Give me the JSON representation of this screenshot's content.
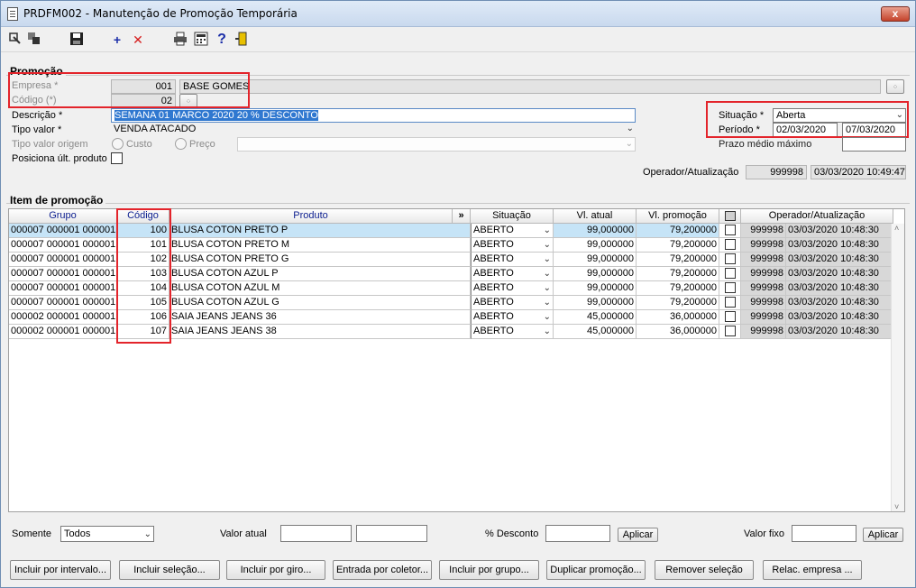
{
  "window": {
    "title": "PRDFM002 - Manutenção de Promoção Temporária",
    "close_symbol": "x"
  },
  "toolbar": {
    "icons": [
      "exit-icon",
      "copy-icon",
      "save-icon",
      "add-icon",
      "delete-icon",
      "print-icon",
      "calculator-icon",
      "help-icon",
      "door-icon"
    ],
    "add_glyph": "+",
    "delete_glyph": "✕",
    "help_glyph": "?"
  },
  "promocao": {
    "group_title": "Promoção",
    "empresa_label": "Empresa *",
    "empresa_code": "001",
    "empresa_name": "BASE GOMES",
    "codigo_label": "Código (*)",
    "codigo_value": "02",
    "descricao_label": "Descrição *",
    "descricao_value": "SEMANA 01 MARCO 2020 20 % DESCONTO",
    "tipo_valor_label": "Tipo valor *",
    "tipo_valor_value": "VENDA ATACADO",
    "tipo_valor_origem_label": "Tipo valor origem",
    "radio_custo": "Custo",
    "radio_preco": "Preço",
    "posiciona_label": "Posiciona últ. produto",
    "situacao_label": "Situação *",
    "situacao_value": "Aberta",
    "periodo_label": "Período *",
    "periodo_inicio": "02/03/2020",
    "periodo_fim": "07/03/2020",
    "prazo_label": "Prazo médio máximo",
    "prazo_value": "",
    "operador_label": "Operador/Atualização",
    "operador_value": "999998",
    "atualizacao_value": "03/03/2020 10:49:47"
  },
  "itens": {
    "group_title": "Item de promoção",
    "columns": {
      "grupo": "Grupo",
      "codigo": "Código",
      "produto": "Produto",
      "expand": "»",
      "situacao": "Situação",
      "vl_atual": "Vl. atual",
      "vl_promocao": "Vl. promoção",
      "operador": "Operador/Atualização"
    },
    "rows": [
      {
        "grupo": "000007 000001 000001",
        "codigo": "100",
        "produto": "BLUSA COTON PRETO P",
        "situacao": "ABERTO",
        "vl_atual": "99,000000",
        "vl_promocao": "79,200000",
        "operador": "999998",
        "atualizacao": "03/03/2020 10:48:30"
      },
      {
        "grupo": "000007 000001 000001",
        "codigo": "101",
        "produto": "BLUSA COTON PRETO M",
        "situacao": "ABERTO",
        "vl_atual": "99,000000",
        "vl_promocao": "79,200000",
        "operador": "999998",
        "atualizacao": "03/03/2020 10:48:30"
      },
      {
        "grupo": "000007 000001 000001",
        "codigo": "102",
        "produto": "BLUSA COTON PRETO G",
        "situacao": "ABERTO",
        "vl_atual": "99,000000",
        "vl_promocao": "79,200000",
        "operador": "999998",
        "atualizacao": "03/03/2020 10:48:30"
      },
      {
        "grupo": "000007 000001 000001",
        "codigo": "103",
        "produto": "BLUSA COTON AZUL P",
        "situacao": "ABERTO",
        "vl_atual": "99,000000",
        "vl_promocao": "79,200000",
        "operador": "999998",
        "atualizacao": "03/03/2020 10:48:30"
      },
      {
        "grupo": "000007 000001 000001",
        "codigo": "104",
        "produto": "BLUSA COTON AZUL M",
        "situacao": "ABERTO",
        "vl_atual": "99,000000",
        "vl_promocao": "79,200000",
        "operador": "999998",
        "atualizacao": "03/03/2020 10:48:30"
      },
      {
        "grupo": "000007 000001 000001",
        "codigo": "105",
        "produto": "BLUSA COTON AZUL G",
        "situacao": "ABERTO",
        "vl_atual": "99,000000",
        "vl_promocao": "79,200000",
        "operador": "999998",
        "atualizacao": "03/03/2020 10:48:30"
      },
      {
        "grupo": "000002 000001 000001",
        "codigo": "106",
        "produto": "SAIA JEANS JEANS 36",
        "situacao": "ABERTO",
        "vl_atual": "45,000000",
        "vl_promocao": "36,000000",
        "operador": "999998",
        "atualizacao": "03/03/2020 10:48:30"
      },
      {
        "grupo": "000002 000001 000001",
        "codigo": "107",
        "produto": "SAIA JEANS JEANS 38",
        "situacao": "ABERTO",
        "vl_atual": "45,000000",
        "vl_promocao": "36,000000",
        "operador": "999998",
        "atualizacao": "03/03/2020 10:48:30"
      }
    ]
  },
  "filters": {
    "somente_label": "Somente",
    "somente_value": "Todos",
    "valor_atual_label": "Valor atual",
    "desconto_label": "% Desconto",
    "aplicar_label": "Aplicar",
    "valor_fixo_label": "Valor fixo"
  },
  "buttons": [
    "Incluir por intervalo...",
    "Incluir seleção...",
    "Incluir por giro...",
    "Entrada por coletor...",
    "Incluir por grupo...",
    "Duplicar promoção...",
    "Remover seleção",
    "Relac. empresa ..."
  ],
  "highlight_color": "#e3242b"
}
